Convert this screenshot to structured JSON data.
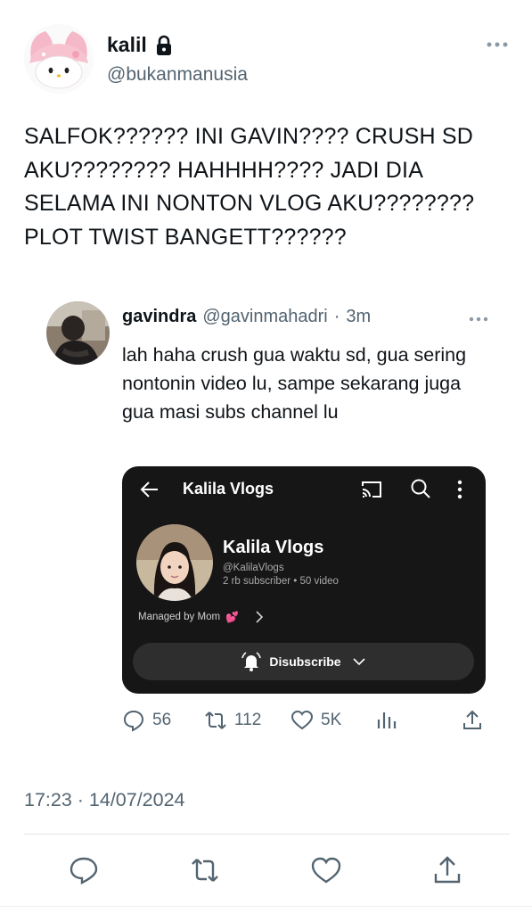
{
  "author": {
    "display_name": "kalil",
    "handle": "@bukanmanusia",
    "avatar": "my-melody-avatar",
    "protected_icon": "lock-icon"
  },
  "tweet": {
    "text": "SALFOK?????? INI GAVIN???? CRUSH SD AKU???????? HAHHHH???? JADI DIA SELAMA INI NONTON VLOG AKU???????? PLOT TWIST BANGETT??????"
  },
  "reply": {
    "name": "gavindra",
    "handle": "@gavinmahadri",
    "separator": "·",
    "time": "3m",
    "text": "lah haha crush gua waktu sd, gua sering nontonin video lu, sampe sekarang juga gua masi subs channel lu",
    "embed": {
      "header_title": "Kalila Vlogs",
      "channel_name": "Kalila Vlogs",
      "channel_handle": "@KalilaVlogs",
      "channel_stats": "2 rb subscriber • 50 video",
      "managed_by": "Managed by Mom",
      "managed_emoji": "💕",
      "subscribe_label": "Disubscribe"
    },
    "counts": {
      "replies": "56",
      "retweets": "112",
      "likes": "5K"
    }
  },
  "timestamp": "17:23 · 14/07/2024",
  "colors": {
    "text": "#0f1419",
    "secondary": "#536471",
    "embed_bg": "#161616",
    "divider": "#e1e6ea"
  }
}
